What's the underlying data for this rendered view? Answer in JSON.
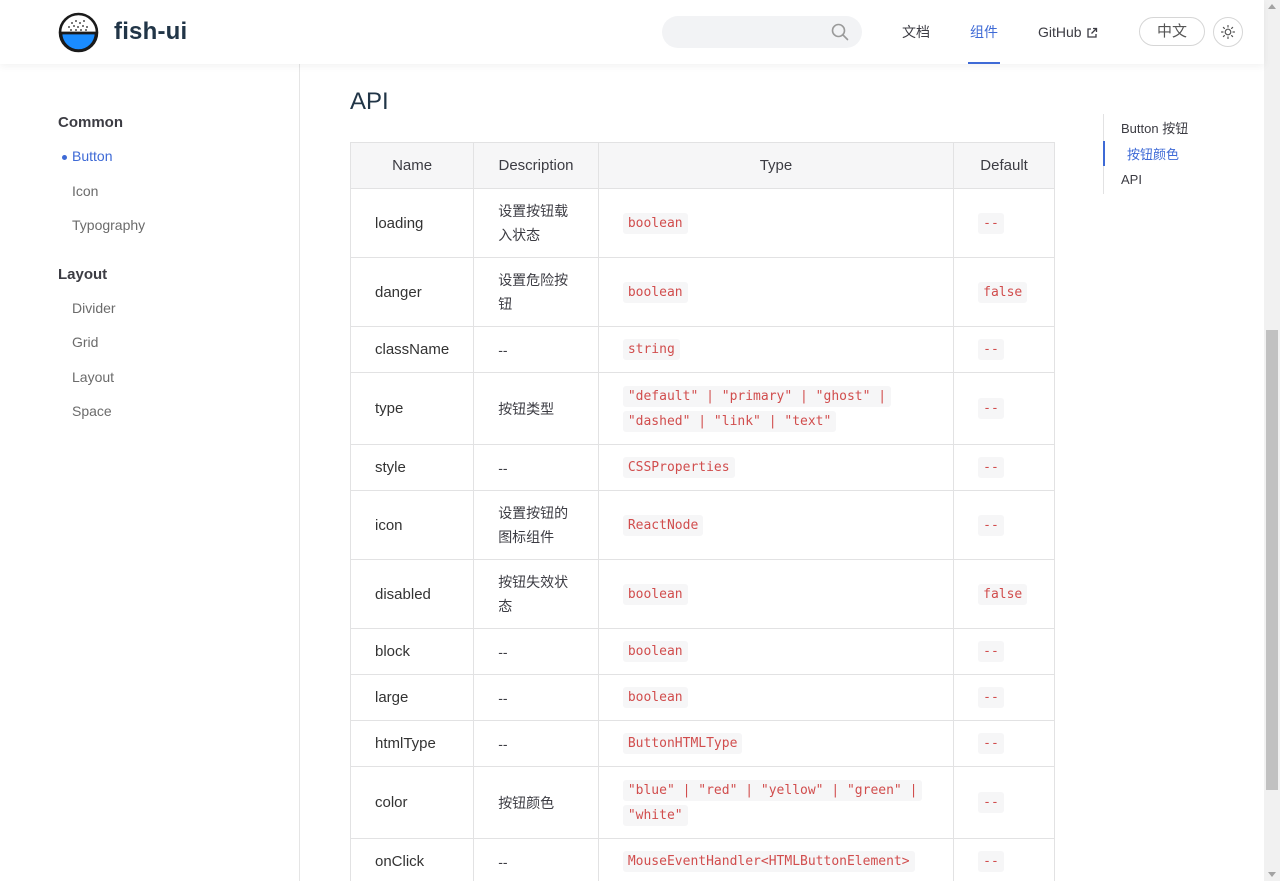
{
  "header": {
    "brand": "fish-ui",
    "search_placeholder": "",
    "nav": {
      "docs": "文档",
      "components": "组件",
      "github": "GitHub"
    },
    "lang": "中文"
  },
  "sidebar": {
    "groups": [
      {
        "title": "Common",
        "items": [
          "Button",
          "Icon",
          "Typography"
        ]
      },
      {
        "title": "Layout",
        "items": [
          "Divider",
          "Grid",
          "Layout",
          "Space"
        ]
      }
    ],
    "active_item": "Button"
  },
  "main": {
    "title": "API",
    "table": {
      "headers": [
        "Name",
        "Description",
        "Type",
        "Default"
      ],
      "rows": [
        {
          "name": "loading",
          "desc": "设置按钮载入状态",
          "type": "boolean",
          "default": "--"
        },
        {
          "name": "danger",
          "desc": "设置危险按钮",
          "type": "boolean",
          "default": "false"
        },
        {
          "name": "className",
          "desc": "--",
          "type": "string",
          "default": "--"
        },
        {
          "name": "type",
          "desc": "按钮类型",
          "type": "\"default\" | \"primary\" | \"ghost\" | \"dashed\" | \"link\" | \"text\"",
          "default": "--"
        },
        {
          "name": "style",
          "desc": "--",
          "type": "CSSProperties",
          "default": "--"
        },
        {
          "name": "icon",
          "desc": "设置按钮的图标组件",
          "type": "ReactNode",
          "default": "--"
        },
        {
          "name": "disabled",
          "desc": "按钮失效状态",
          "type": "boolean",
          "default": "false"
        },
        {
          "name": "block",
          "desc": "--",
          "type": "boolean",
          "default": "--"
        },
        {
          "name": "large",
          "desc": "--",
          "type": "boolean",
          "default": "--"
        },
        {
          "name": "htmlType",
          "desc": "--",
          "type": "ButtonHTMLType",
          "default": "--"
        },
        {
          "name": "color",
          "desc": "按钮颜色",
          "type": "\"blue\" | \"red\" | \"yellow\" | \"green\" | \"white\"",
          "default": "--"
        },
        {
          "name": "onClick",
          "desc": "--",
          "type": "MouseEventHandler<HTMLButtonElement>",
          "default": "--"
        }
      ]
    }
  },
  "outline": {
    "items": [
      "Button 按钮",
      "按钮颜色",
      "API"
    ],
    "active": "按钮颜色"
  },
  "colors": {
    "accent": "#3e6ad6",
    "code": "#d14d4d",
    "logo_blue": "#1a8cff"
  },
  "icons": {
    "search": "search-icon",
    "external": "external-link-icon",
    "theme": "sun-icon"
  }
}
